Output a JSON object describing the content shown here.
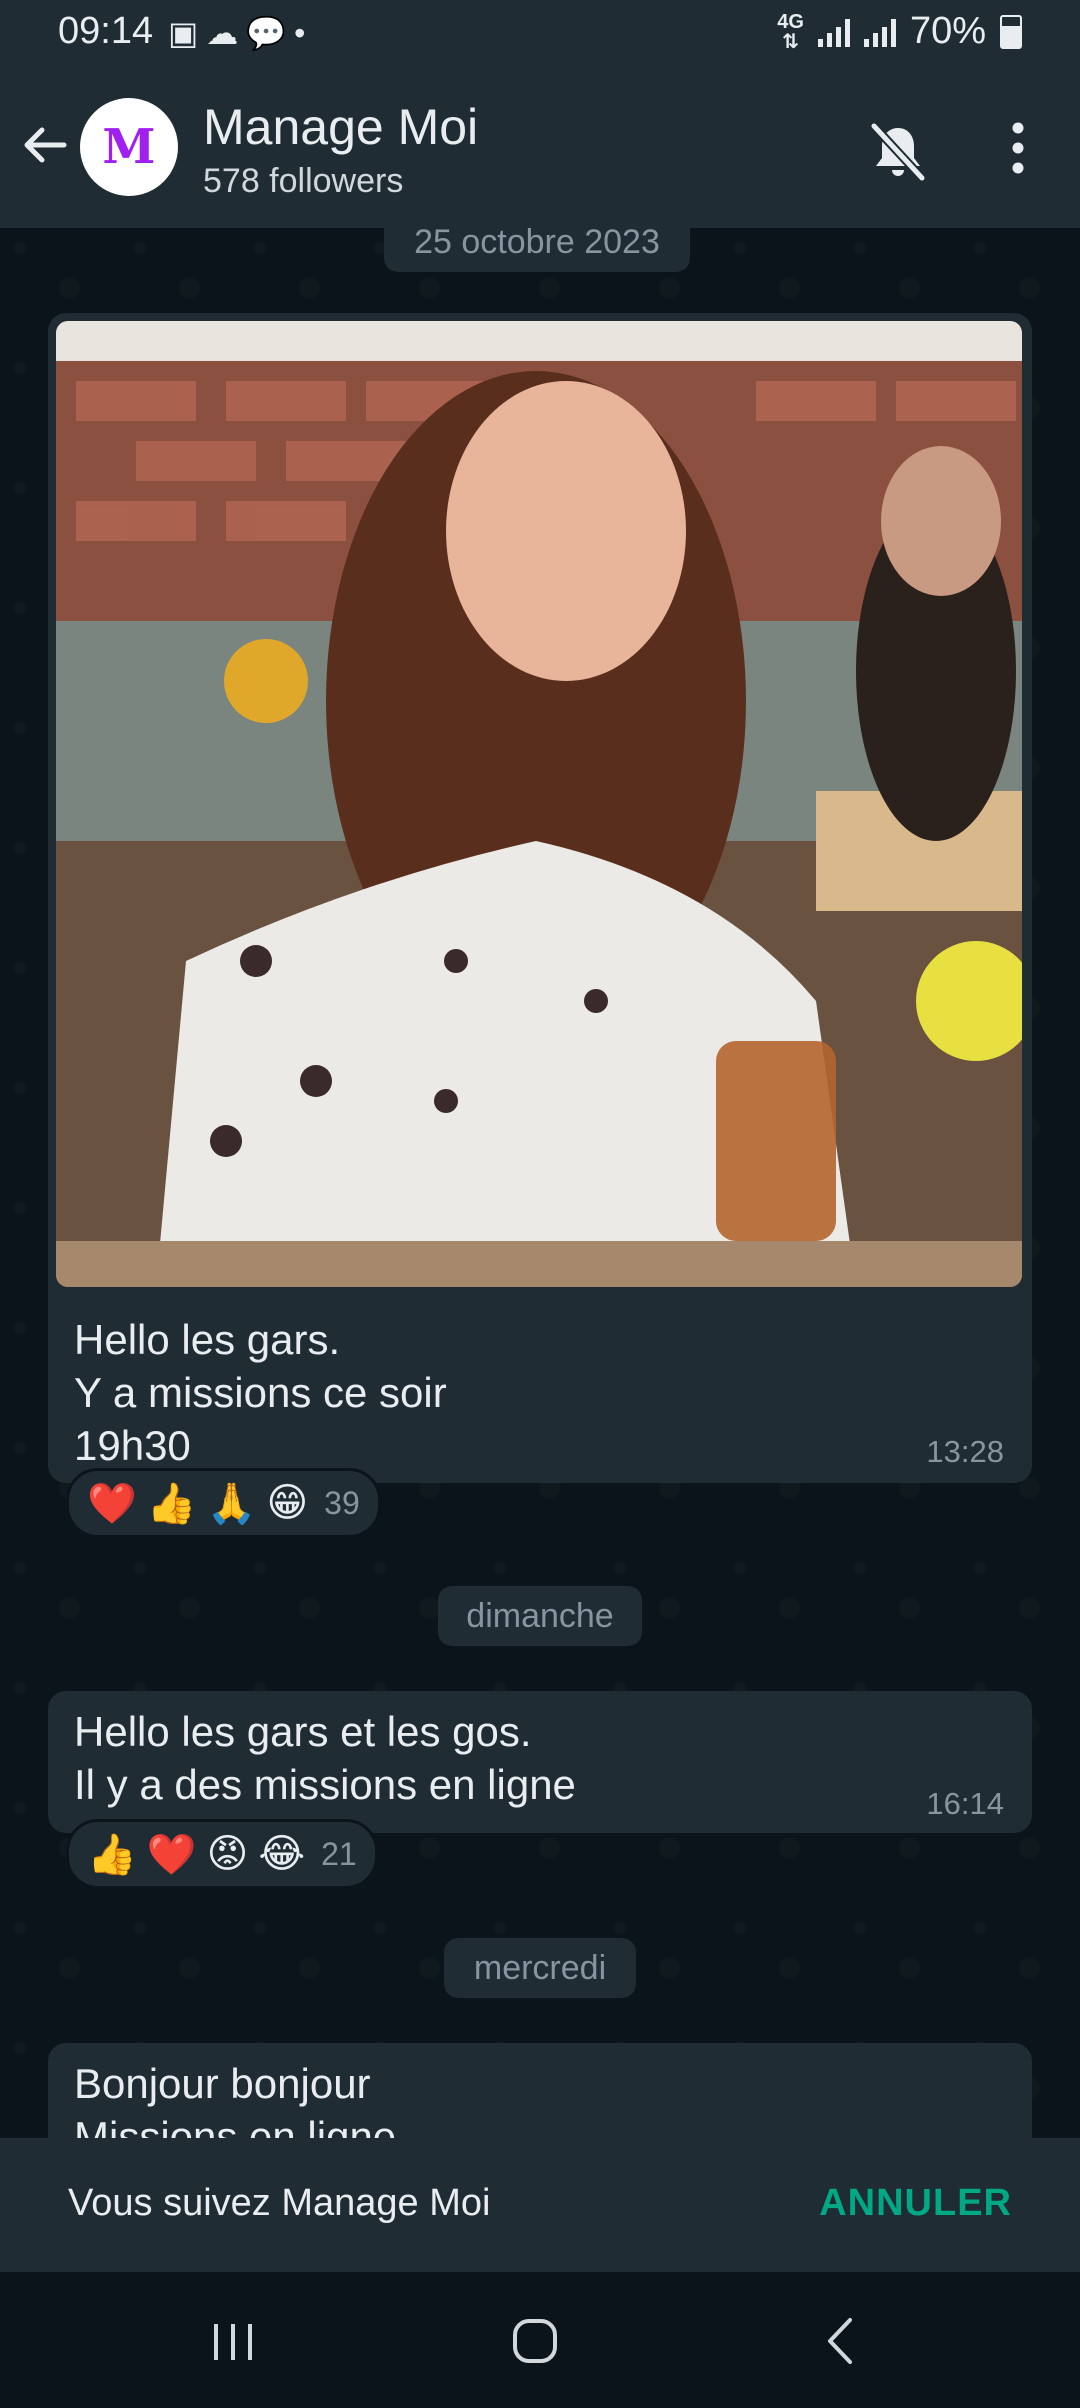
{
  "status_bar": {
    "time": "09:14",
    "network": "4G",
    "battery": "70%",
    "battery_level": 0.7,
    "icons": [
      "image-icon",
      "cloud-icon",
      "chat-bubble-icon",
      "dot-icon"
    ]
  },
  "header": {
    "channel_name": "Manage Moi",
    "followers": "578 followers",
    "avatar_icon": "manage-moi-logo",
    "avatar_letter": "M"
  },
  "chat": {
    "date_1": "25 octobre 2023",
    "message_1": {
      "text": "Hello les gars.\nY a missions ce soir\n19h30",
      "time": "13:28",
      "reactions": [
        "❤️",
        "👍",
        "🙏",
        "😁"
      ],
      "reaction_count": "39"
    },
    "date_2": "dimanche",
    "message_2": {
      "text": "Hello les gars et les gos.\nIl y a des missions en ligne",
      "time": "16:14",
      "reactions": [
        "👍",
        "❤️",
        "😡",
        "😂"
      ],
      "reaction_count": "21"
    },
    "date_3": "mercredi",
    "message_3": {
      "text": "Bonjour bonjour\nMissions en ligne"
    }
  },
  "follow_bar": {
    "text": "Vous suivez Manage Moi",
    "cancel_label": "ANNULER"
  },
  "colors": {
    "accent": "#00a884",
    "bubble": "#1f2c34",
    "background": "#0b141a"
  }
}
